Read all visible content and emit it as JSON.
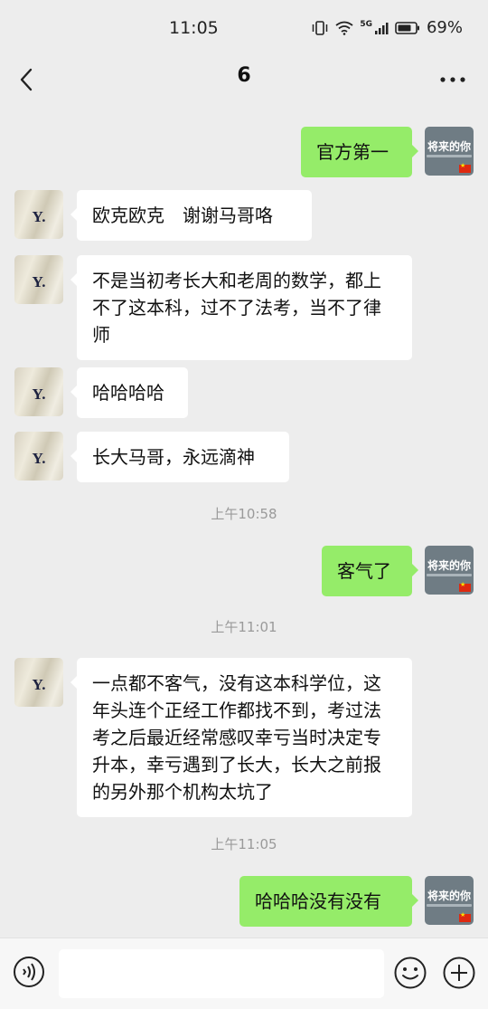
{
  "status_bar": {
    "time": "11:05",
    "network": "5G",
    "battery": "69%"
  },
  "nav": {
    "title": "6"
  },
  "avatars": {
    "contact_letter": "Y.",
    "self_title": "将来的你"
  },
  "messages": [
    {
      "side": "out",
      "text": "官方第一"
    },
    {
      "side": "in",
      "text": "欧克欧克　谢谢马哥咯"
    },
    {
      "side": "in",
      "text": "不是当初考长大和老周的数学，都上不了这本科，过不了法考，当不了律师"
    },
    {
      "side": "in",
      "text": "哈哈哈哈"
    },
    {
      "side": "in",
      "text": "长大马哥，永远滴神"
    },
    {
      "timestamp": "上午10:58"
    },
    {
      "side": "out",
      "text": "客气了"
    },
    {
      "timestamp": "上午11:01"
    },
    {
      "side": "in",
      "text": "一点都不客气，没有这本科学位，这年头连个正经工作都找不到，考过法考之后最近经常感叹幸亏当时决定专升本，幸亏遇到了长大，长大之前报的另外那个机构太坑了"
    },
    {
      "timestamp": "上午11:05"
    },
    {
      "side": "out",
      "text": "哈哈哈没有没有"
    }
  ],
  "input": {
    "value": "",
    "placeholder": ""
  },
  "colors": {
    "background": "#ededed",
    "outgoing_bubble": "#95ec69",
    "incoming_bubble": "#ffffff",
    "timestamp_text": "#9a9a9a"
  }
}
